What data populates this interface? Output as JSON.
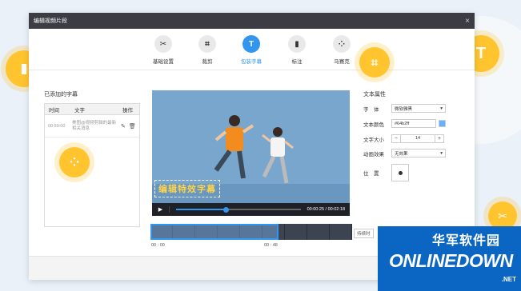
{
  "window": {
    "title": "编辑视频片段",
    "close": "×"
  },
  "toolbar": [
    {
      "label": "基础设置",
      "icon": "scissors-icon",
      "glyph": "✂"
    },
    {
      "label": "裁剪",
      "icon": "crop-icon",
      "glyph": "⌗"
    },
    {
      "label": "包装字幕",
      "icon": "text-icon",
      "glyph": "T",
      "active": true
    },
    {
      "label": "标注",
      "icon": "bookmark-icon",
      "glyph": "▮"
    },
    {
      "label": "马赛克",
      "icon": "mosaic-icon",
      "glyph": "⁘"
    }
  ],
  "subtitles": {
    "title": "已添加的字幕",
    "headers": [
      "时间",
      "文字",
      "操作"
    ],
    "rows": [
      {
        "time": "00:50:00",
        "text": "美图@视频剪辑的最新相关消息"
      }
    ]
  },
  "player": {
    "caption": "编辑特效字幕",
    "time": "00:00:25 / 00:02:18",
    "play": "▶",
    "progress": 0.25
  },
  "props": {
    "title": "文本属性",
    "font_label": "字　体",
    "font_value": "微软雅黑",
    "color_label": "文本颜色",
    "color_value": "#64b2ff",
    "size_label": "文字大小",
    "size_value": "14",
    "minus": "−",
    "plus": "+",
    "anim_label": "动画效果",
    "anim_value": "无效果",
    "pos_label": "位　置"
  },
  "timeline": {
    "start": "00 : 00",
    "mark": "00 : 48",
    "hint": "持续时"
  },
  "brand": {
    "cn": "华军软件园",
    "en": "ONLINEDOWN",
    "net": ".NET"
  },
  "colors": {
    "accent": "#3296f0",
    "float": "#ffc42e"
  }
}
